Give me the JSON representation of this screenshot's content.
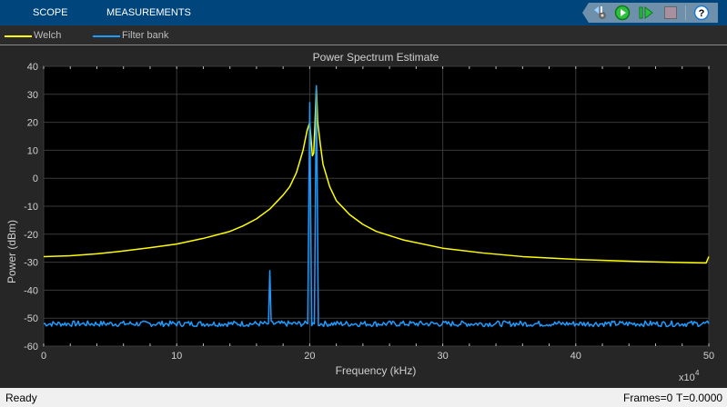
{
  "toolbar": {
    "tabs": [
      "SCOPE",
      "MEASUREMENTS"
    ],
    "icons": [
      "settings-icon",
      "run-icon",
      "step-forward-icon",
      "stop-icon",
      "help-icon"
    ]
  },
  "legend": [
    {
      "label": "Welch",
      "color": "#ffff00"
    },
    {
      "label": "Filter bank",
      "color": "#1e9bff"
    }
  ],
  "status": {
    "left": "Ready",
    "frames": "Frames=0",
    "time": "T=0.0000"
  },
  "chart_data": {
    "type": "line",
    "title": "Power Spectrum Estimate",
    "xlabel": "Frequency (kHz)",
    "ylabel": "Power (dBm)",
    "x_multiplier": "x10",
    "x_multiplier_exp": "4",
    "xlim": [
      0,
      50
    ],
    "ylim": [
      -60,
      40
    ],
    "xticks": [
      0,
      10,
      20,
      30,
      40,
      50
    ],
    "yticks": [
      40,
      30,
      20,
      10,
      0,
      -10,
      -20,
      -30,
      -40,
      -50,
      -60
    ],
    "grid": true,
    "legend_position": "top",
    "series": [
      {
        "name": "Welch",
        "color": "#ffff00",
        "x": [
          0,
          2,
          4,
          6,
          8,
          10,
          12,
          14,
          15,
          16,
          17,
          18,
          18.5,
          19,
          19.5,
          19.8,
          20,
          20.1,
          20.2,
          20.3,
          20.4,
          20.5,
          20.6,
          20.8,
          21,
          21.5,
          22,
          23,
          24,
          25,
          27,
          30,
          33,
          36,
          40,
          45,
          49.8,
          50
        ],
        "y": [
          -28,
          -27.7,
          -27,
          -26,
          -24.8,
          -23.5,
          -21.5,
          -19,
          -17,
          -14.5,
          -11,
          -6,
          -3,
          2,
          10,
          17,
          20,
          14,
          8,
          9,
          20,
          33,
          20,
          12,
          5,
          -3,
          -8,
          -13,
          -16.5,
          -19,
          -22,
          -25,
          -26.7,
          -28,
          -29,
          -29.8,
          -30.3,
          -28
        ]
      },
      {
        "name": "Filter bank",
        "color": "#1e9bff",
        "x": [
          0,
          16.9,
          17,
          17.1,
          19.85,
          20,
          20.15,
          20.35,
          20.5,
          20.65,
          50
        ],
        "y": [
          -52,
          -52,
          -33,
          -52,
          -52,
          27,
          -52,
          -52,
          33,
          -52,
          -52
        ]
      }
    ]
  }
}
